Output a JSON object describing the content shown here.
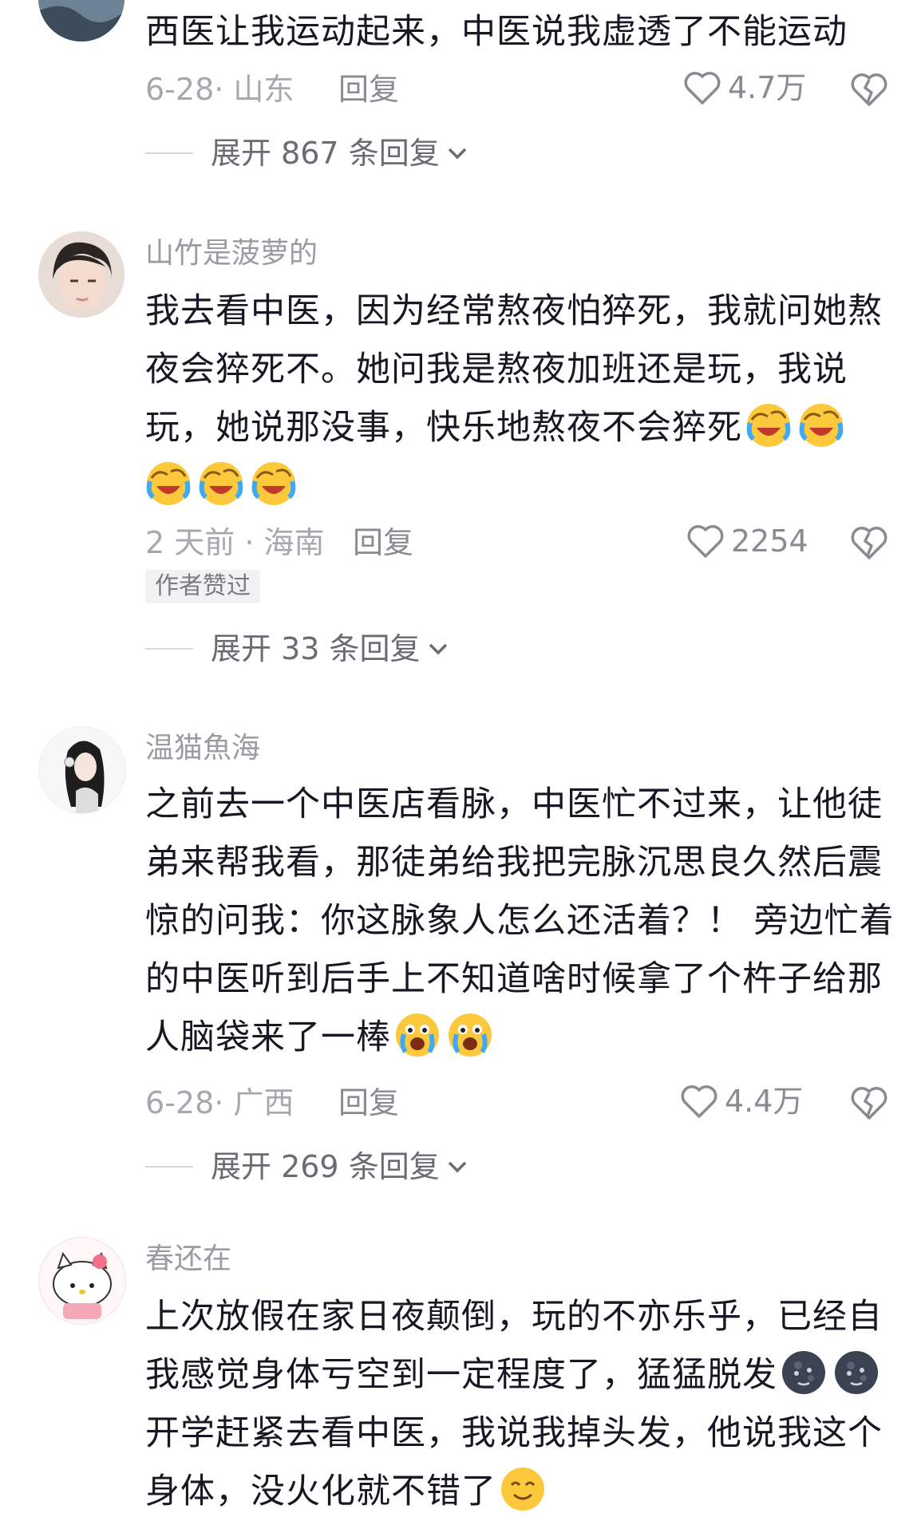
{
  "comments": [
    {
      "username": "",
      "text": "西医让我运动起来，中医说我虚透了不能运动",
      "emojis": [],
      "date_location": "6-28· 山东",
      "reply_label": "回复",
      "likes": "4.7万",
      "author_badge": "",
      "expand_label": "展开 867 条回复"
    },
    {
      "username": "山竹是菠萝的",
      "text": "我去看中医，因为经常熬夜怕猝死，我就问她熬夜会猝死不。她问我是熬夜加班还是玩，我说玩，她说那没事，快乐地熬夜不会猝死",
      "emojis": [
        "laugh-cry-emoji",
        "laugh-cry-emoji",
        "laugh-cry-emoji",
        "laugh-cry-emoji",
        "laugh-cry-emoji"
      ],
      "date_location": "2 天前 · 海南",
      "reply_label": "回复",
      "likes": "2254",
      "author_badge": "作者赞过",
      "expand_label": "展开 33 条回复"
    },
    {
      "username": "温猫魚海",
      "text": "之前去一个中医店看脉，中医忙不过来，让他徒弟来帮我看，那徒弟给我把完脉沉思良久然后震惊的问我：你这脉象人怎么还活着？！ 旁边忙着的中医听到后手上不知道啥时候拿了个杵子给那人脑袋来了一棒",
      "emojis": [
        "shocked-cry-emoji",
        "shocked-cry-emoji"
      ],
      "date_location": "6-28· 广西",
      "reply_label": "回复",
      "likes": "4.4万",
      "author_badge": "",
      "expand_label": "展开 269 条回复"
    },
    {
      "username": "春还在",
      "text_part1": "上次放假在家日夜颠倒，玩的不亦乐乎，已经自我感觉身体亏空到一定程度了，猛猛脱发",
      "emojis_part1": [
        "moon-face-emoji",
        "moon-face-emoji"
      ],
      "text_part2": "开学赶紧去看中医，我说我掉头发，他说我这个身体，没火化就不错了",
      "emojis_part2": [
        "smile-emoji"
      ]
    }
  ],
  "colors": {
    "text": "#161823",
    "meta": "#a7a7ae",
    "username": "#9b9ba3",
    "badge_bg": "#f2f2f4"
  },
  "icons": {
    "like": "heart-outline-icon",
    "dislike": "broken-heart-icon",
    "expand": "chevron-down-icon"
  }
}
